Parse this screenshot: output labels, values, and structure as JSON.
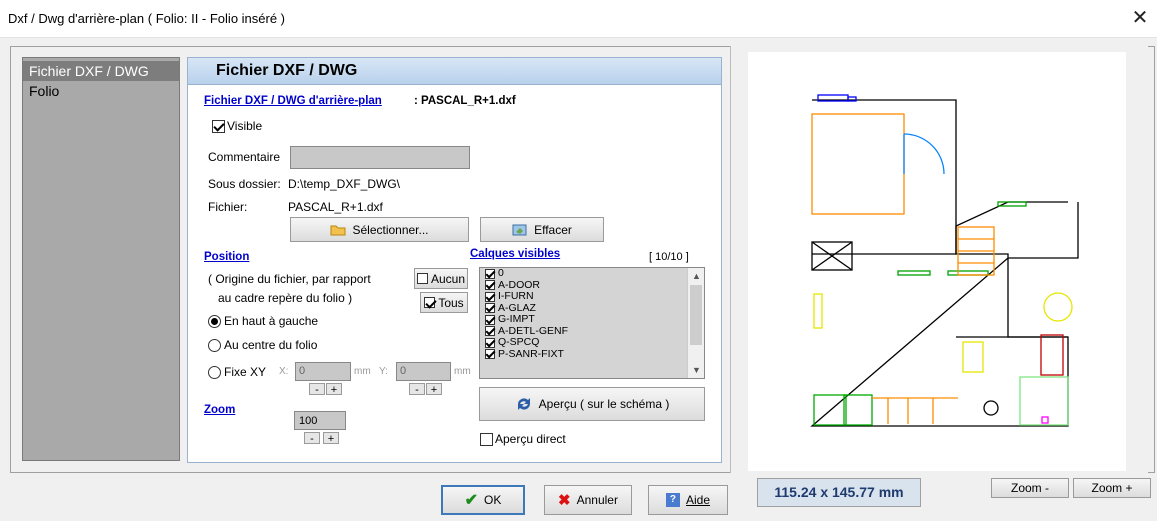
{
  "window": {
    "title": "Dxf / Dwg d'arrière-plan ( Folio: II - Folio inséré )",
    "close_symbol": "✕"
  },
  "sidebar": {
    "items": [
      {
        "label": "Fichier DXF / DWG"
      },
      {
        "label": "Folio"
      }
    ]
  },
  "panel": {
    "header": "Fichier DXF / DWG",
    "file_link": "Fichier DXF / DWG d'arrière-plan",
    "file_value": ": PASCAL_R+1.dxf",
    "visible_label": "Visible",
    "comment_label": "Commentaire",
    "comment_value": "",
    "subfolder_label": "Sous dossier:",
    "subfolder_value": "D:\\temp_DXF_DWG\\",
    "file_label": "Fichier:",
    "file_name": "PASCAL_R+1.dxf",
    "select_button": "Sélectionner...",
    "clear_button": "Effacer",
    "position_heading": "Position",
    "origin_line1": "( Origine du fichier, par rapport",
    "origin_line2": "au cadre repère du folio )",
    "none_button": "Aucun",
    "all_button": "Tous",
    "radio_top_left": "En haut à gauche",
    "radio_center": "Au centre du folio",
    "radio_fixed": "Fixe XY",
    "x_label": "X:",
    "x_value": "0",
    "y_label": "Y:",
    "y_value": "0",
    "mm_unit": "mm",
    "minus": "-",
    "plus": "+",
    "layers_heading": "Calques visibles",
    "layers_count": "[ 10/10 ]",
    "layers": [
      "0",
      "A-DOOR",
      "I-FURN",
      "A-GLAZ",
      "G-IMPT",
      "A-DETL-GENF",
      "Q-SPCQ",
      "P-SANR-FIXT"
    ],
    "zoom_heading": "Zoom",
    "zoom_value": "100",
    "preview_button": "Aperçu ( sur le schéma )",
    "direct_preview_label": "Aperçu direct"
  },
  "preview": {
    "dimensions": "115.24  x 145.77 mm",
    "zoom_minus": "Zoom -",
    "zoom_plus": "Zoom +"
  },
  "footer": {
    "ok": "OK",
    "cancel": "Annuler",
    "help": "Aide"
  },
  "colors": {
    "header_blue": "#b9d1ec",
    "link_blue": "#0000cc",
    "dim_text": "#1f3b6e"
  },
  "icons": {
    "folder": "folder-icon",
    "eraser": "eraser-icon",
    "refresh": "refresh-icon",
    "ok": "checkmark-icon",
    "cancel": "cross-icon",
    "help": "help-icon"
  }
}
